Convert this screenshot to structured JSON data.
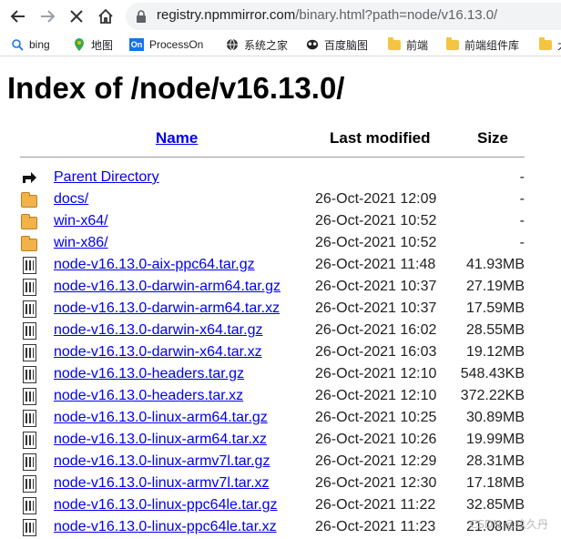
{
  "browser": {
    "url_host": "registry.npmmirror.com",
    "url_path": "/binary.html?path=node/v16.13.0/",
    "bookmarks": [
      {
        "label": "bing",
        "icon": "search-icon"
      },
      {
        "label": "地图",
        "icon": "map-pin-icon"
      },
      {
        "label": "ProcessOn",
        "icon": "processon-logo-icon"
      },
      {
        "label": "系统之家",
        "icon": "globe-icon"
      },
      {
        "label": "百度脑图",
        "icon": "brain-map-icon"
      },
      {
        "label": "前端",
        "icon": "folder-icon"
      },
      {
        "label": "前端组件库",
        "icon": "folder-icon"
      },
      {
        "label": "大",
        "icon": "folder-icon"
      }
    ]
  },
  "page": {
    "title": "Index of /node/v16.13.0/",
    "columns": {
      "name": "Name",
      "modified": "Last modified",
      "size": "Size"
    },
    "rows": [
      {
        "icon": "parent-directory-icon",
        "name": "Parent Directory",
        "date": "",
        "size": "-"
      },
      {
        "icon": "folder-icon",
        "name": "docs/",
        "date": "26-Oct-2021 12:09",
        "size": "-"
      },
      {
        "icon": "folder-icon",
        "name": "win-x64/",
        "date": "26-Oct-2021 10:52",
        "size": "-"
      },
      {
        "icon": "folder-icon",
        "name": "win-x86/",
        "date": "26-Oct-2021 10:52",
        "size": "-"
      },
      {
        "icon": "binary-file-icon",
        "name": "node-v16.13.0-aix-ppc64.tar.gz",
        "date": "26-Oct-2021 11:48",
        "size": "41.93MB"
      },
      {
        "icon": "binary-file-icon",
        "name": "node-v16.13.0-darwin-arm64.tar.gz",
        "date": "26-Oct-2021 10:37",
        "size": "27.19MB"
      },
      {
        "icon": "binary-file-icon",
        "name": "node-v16.13.0-darwin-arm64.tar.xz",
        "date": "26-Oct-2021 10:37",
        "size": "17.59MB"
      },
      {
        "icon": "binary-file-icon",
        "name": "node-v16.13.0-darwin-x64.tar.gz",
        "date": "26-Oct-2021 16:02",
        "size": "28.55MB"
      },
      {
        "icon": "binary-file-icon",
        "name": "node-v16.13.0-darwin-x64.tar.xz",
        "date": "26-Oct-2021 16:03",
        "size": "19.12MB"
      },
      {
        "icon": "binary-file-icon",
        "name": "node-v16.13.0-headers.tar.gz",
        "date": "26-Oct-2021 12:10",
        "size": "548.43KB"
      },
      {
        "icon": "binary-file-icon",
        "name": "node-v16.13.0-headers.tar.xz",
        "date": "26-Oct-2021 12:10",
        "size": "372.22KB"
      },
      {
        "icon": "binary-file-icon",
        "name": "node-v16.13.0-linux-arm64.tar.gz",
        "date": "26-Oct-2021 10:25",
        "size": "30.89MB"
      },
      {
        "icon": "binary-file-icon",
        "name": "node-v16.13.0-linux-arm64.tar.xz",
        "date": "26-Oct-2021 10:26",
        "size": "19.99MB"
      },
      {
        "icon": "binary-file-icon",
        "name": "node-v16.13.0-linux-armv7l.tar.gz",
        "date": "26-Oct-2021 12:29",
        "size": "28.31MB"
      },
      {
        "icon": "binary-file-icon",
        "name": "node-v16.13.0-linux-armv7l.tar.xz",
        "date": "26-Oct-2021 12:30",
        "size": "17.18MB"
      },
      {
        "icon": "binary-file-icon",
        "name": "node-v16.13.0-linux-ppc64le.tar.gz",
        "date": "26-Oct-2021 11:22",
        "size": "32.85MB"
      },
      {
        "icon": "binary-file-icon",
        "name": "node-v16.13.0-linux-ppc64le.tar.xz",
        "date": "26-Oct-2021 11:23",
        "size": "21.08MB"
      }
    ]
  },
  "watermark": "CSDN @玖久丹",
  "colors": {
    "link": "#0000ee",
    "folder": "#f2b24a"
  }
}
